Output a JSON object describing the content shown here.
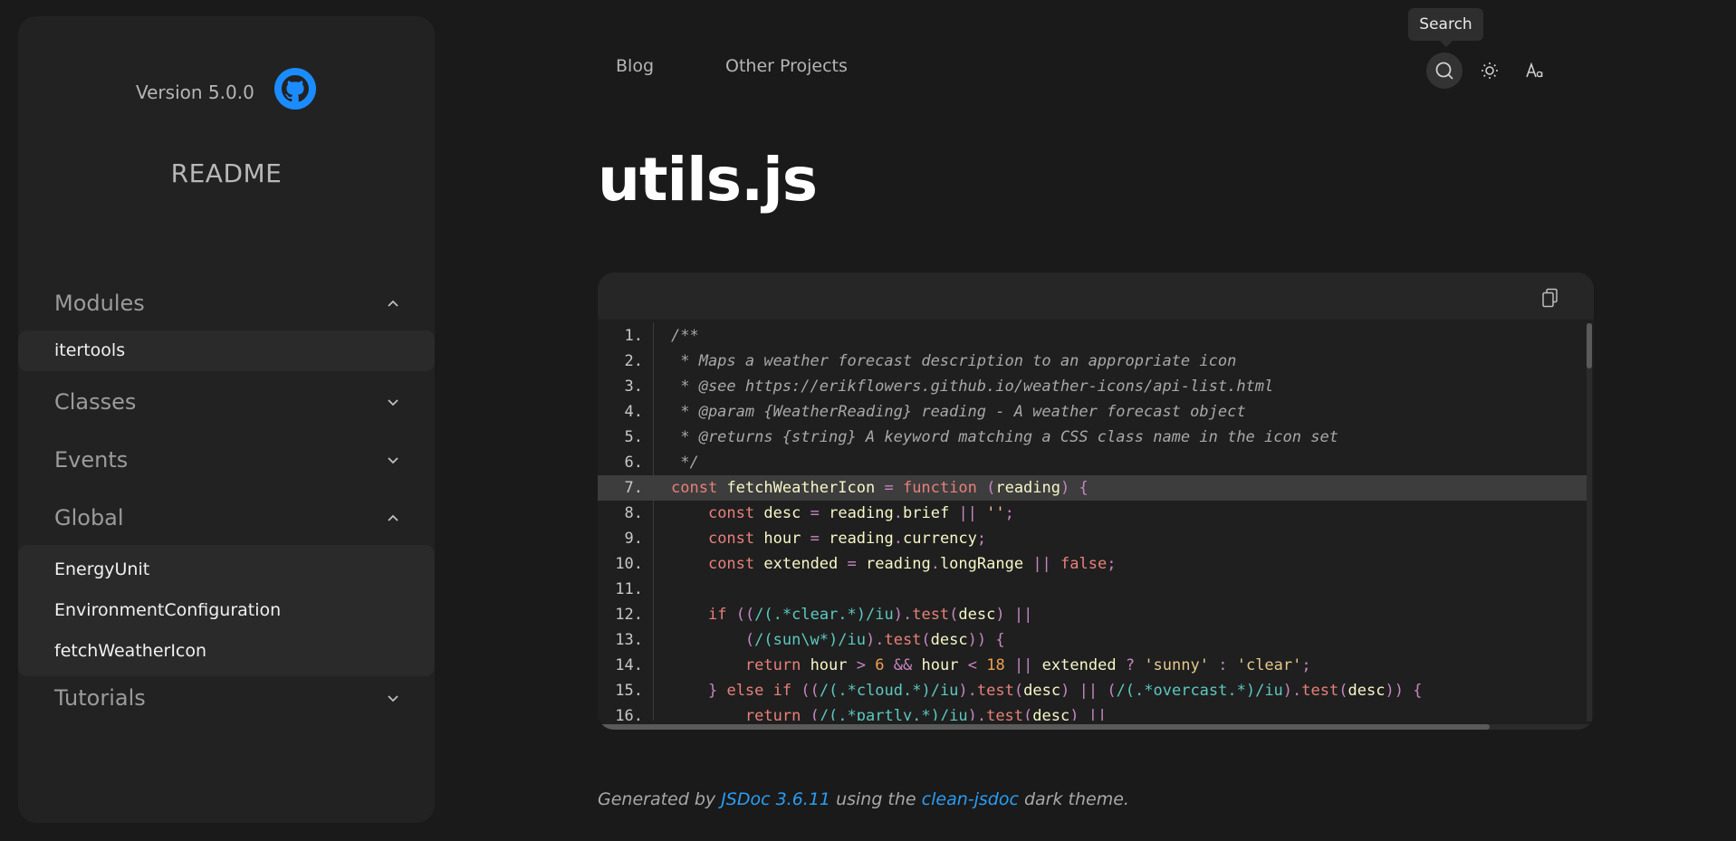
{
  "sidebar": {
    "version": "Version 5.0.0",
    "github_icon": "github-icon",
    "readme": "README",
    "groups": [
      {
        "label": "Modules",
        "expanded": true,
        "items": [
          "itertools"
        ]
      },
      {
        "label": "Classes",
        "expanded": false,
        "items": []
      },
      {
        "label": "Events",
        "expanded": false,
        "items": []
      },
      {
        "label": "Global",
        "expanded": true,
        "items": [
          "EnergyUnit",
          "EnvironmentConfiguration",
          "fetchWeatherIcon"
        ]
      },
      {
        "label": "Tutorials",
        "expanded": false,
        "items": []
      }
    ]
  },
  "topnav": {
    "blog": "Blog",
    "other_projects": "Other Projects",
    "tooltip": "Search",
    "icons": [
      "search-icon",
      "sun-icon",
      "font-size-icon"
    ]
  },
  "page": {
    "title": "utils.js"
  },
  "code": {
    "highlighted_line": 7,
    "lines": [
      {
        "n": "1.",
        "text": "/**"
      },
      {
        "n": "2.",
        "text": " * Maps a weather forecast description to an appropriate icon"
      },
      {
        "n": "3.",
        "text": " * @see https://erikflowers.github.io/weather-icons/api-list.html"
      },
      {
        "n": "4.",
        "text": " * @param {WeatherReading} reading - A weather forecast object"
      },
      {
        "n": "5.",
        "text": " * @returns {string} A keyword matching a CSS class name in the icon set"
      },
      {
        "n": "6.",
        "text": " */"
      },
      {
        "n": "7.",
        "text": "const fetchWeatherIcon = function (reading) {"
      },
      {
        "n": "8.",
        "text": "    const desc = reading.brief || '';"
      },
      {
        "n": "9.",
        "text": "    const hour = reading.currency;"
      },
      {
        "n": "10.",
        "text": "    const extended = reading.longRange || false;"
      },
      {
        "n": "11.",
        "text": ""
      },
      {
        "n": "12.",
        "text": "    if ((/(.*clear.*)/iu).test(desc) ||"
      },
      {
        "n": "13.",
        "text": "        (/(sun\\w*)/iu).test(desc)) {"
      },
      {
        "n": "14.",
        "text": "        return hour > 6 && hour < 18 || extended ? 'sunny' : 'clear';"
      },
      {
        "n": "15.",
        "text": "    } else if ((/(.*cloud.*)/iu).test(desc) || (/(.*overcast.*)/iu).test(desc)) {"
      },
      {
        "n": "16.",
        "text": "        return (/(.*partly.*)/iu).test(desc) ||"
      }
    ]
  },
  "footer": {
    "prefix": "Generated by ",
    "jsdoc_link": "JSDoc 3.6.11",
    "middle": " using the ",
    "theme_link": "clean-jsdoc",
    "suffix": " dark theme."
  }
}
